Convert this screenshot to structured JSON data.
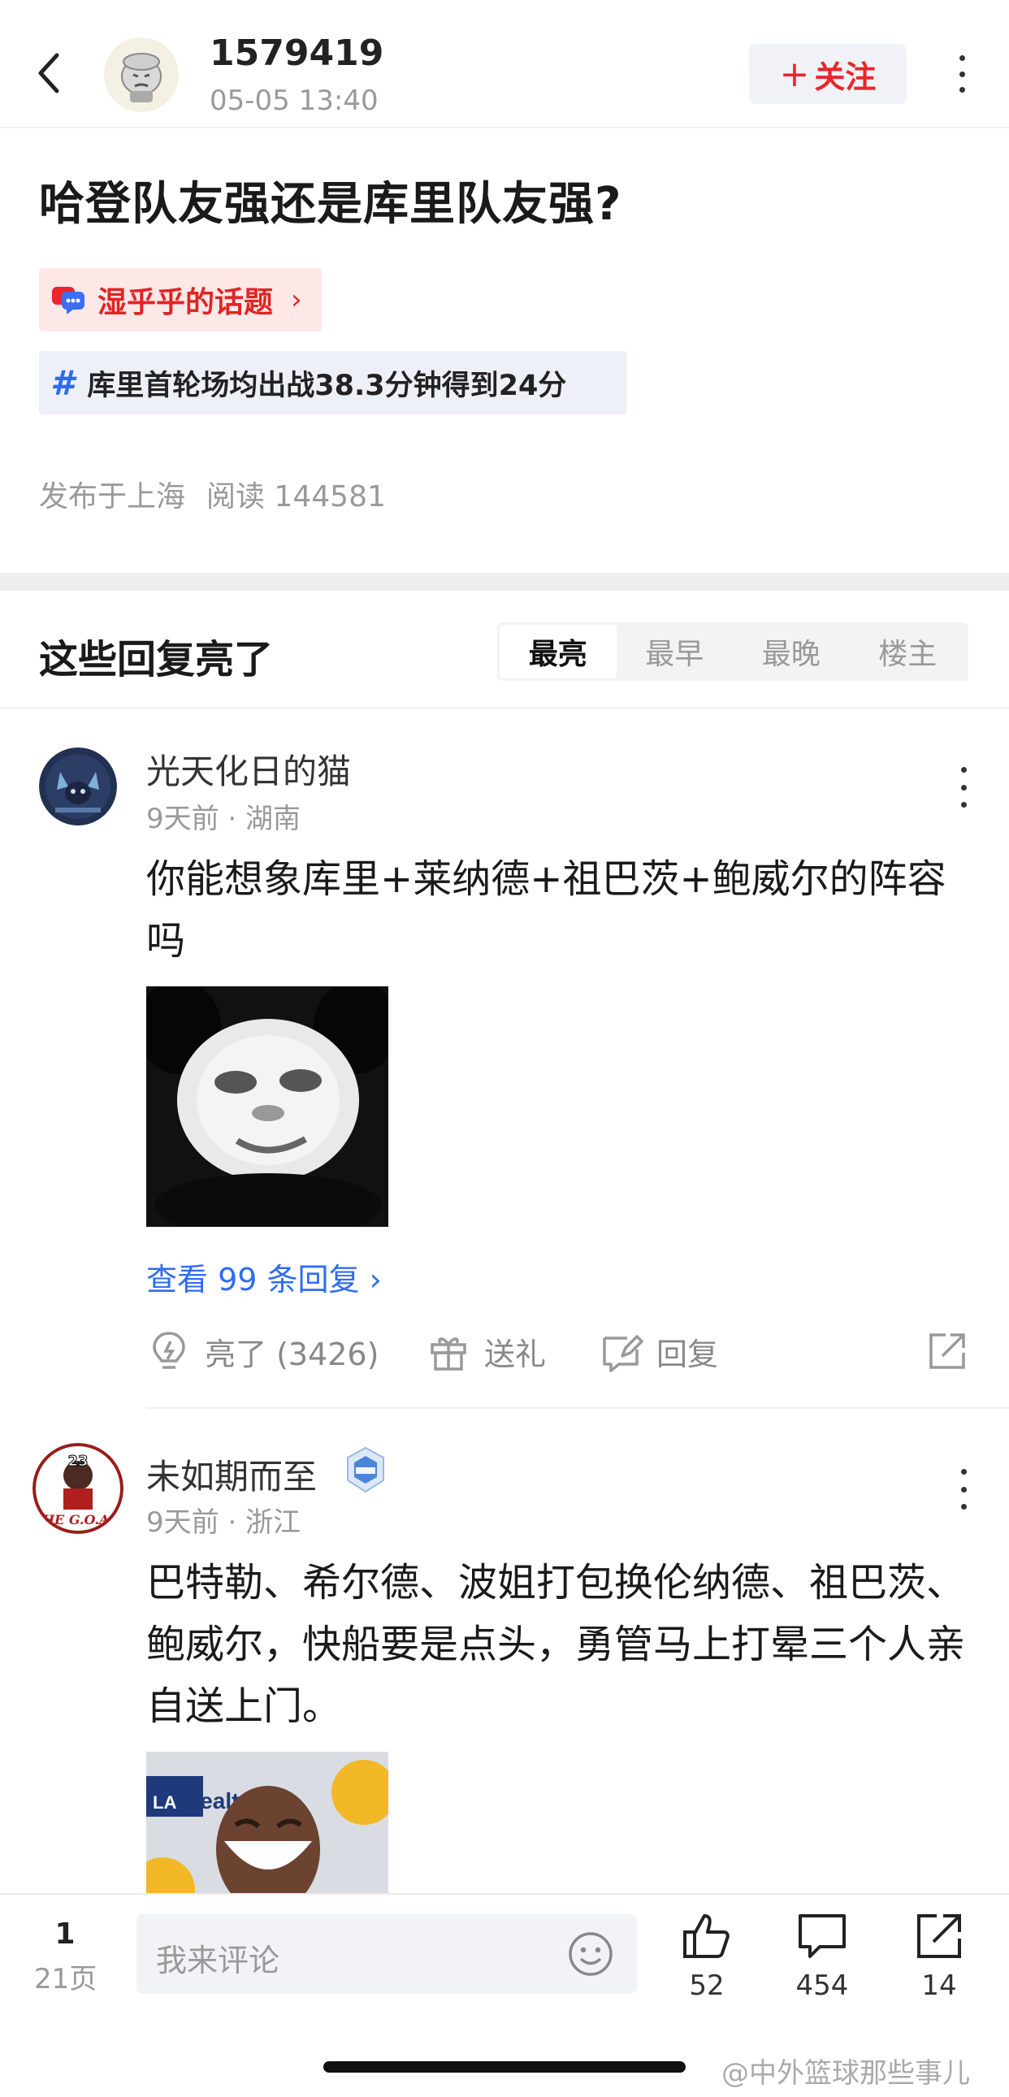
{
  "header": {
    "user_name": "1579419",
    "post_time": "05-05 13:40",
    "follow_label": "关注",
    "follow_plus": "+"
  },
  "post": {
    "title": "哈登队友强还是库里队友强?",
    "topic_label": "湿乎乎的话题",
    "topic_chevron": "›",
    "hashtag_symbol": "#",
    "hashtag_label": "库里首轮场均出战38.3分钟得到24分",
    "published_at": "发布于上海",
    "reads": "阅读 144581"
  },
  "replies_section": {
    "title": "这些回复亮了",
    "tabs": [
      {
        "label": "最亮",
        "active": true
      },
      {
        "label": "最早",
        "active": false
      },
      {
        "label": "最晚",
        "active": false
      },
      {
        "label": "楼主",
        "active": false
      }
    ]
  },
  "comments": [
    {
      "name": "光天化日的猫",
      "meta": "9天前 · 湖南",
      "text": "你能想象库里+莱纳德+祖巴茨+鲍威尔的阵容吗",
      "view_replies": "查看 99 条回复 ›",
      "light_label": "亮了 (3426)",
      "gift_label": "送礼",
      "reply_label": "回复"
    },
    {
      "name": "未如期而至",
      "meta": "9天前 · 浙江",
      "text": "巴特勒、希尔德、波姐打包换伦纳德、祖巴茨、鲍威尔，快船要是点头，勇管马上打晕三个人亲自送上门。",
      "avatar_text": "THE G.O.A.T",
      "avatar_number": "23",
      "image_text_1": "Healt",
      "image_text_2": "LA"
    }
  ],
  "bottom_bar": {
    "page_current": "1",
    "page_total": "21页",
    "comment_placeholder": "我来评论",
    "likes": "52",
    "comments": "454",
    "shares": "14"
  },
  "watermark": "@中外篮球那些事儿",
  "colors": {
    "accent_red": "#e8262c",
    "link_blue": "#2f6cf1",
    "tag_bg": "#fde8e8",
    "hashtag_bg": "#eef0f8"
  }
}
